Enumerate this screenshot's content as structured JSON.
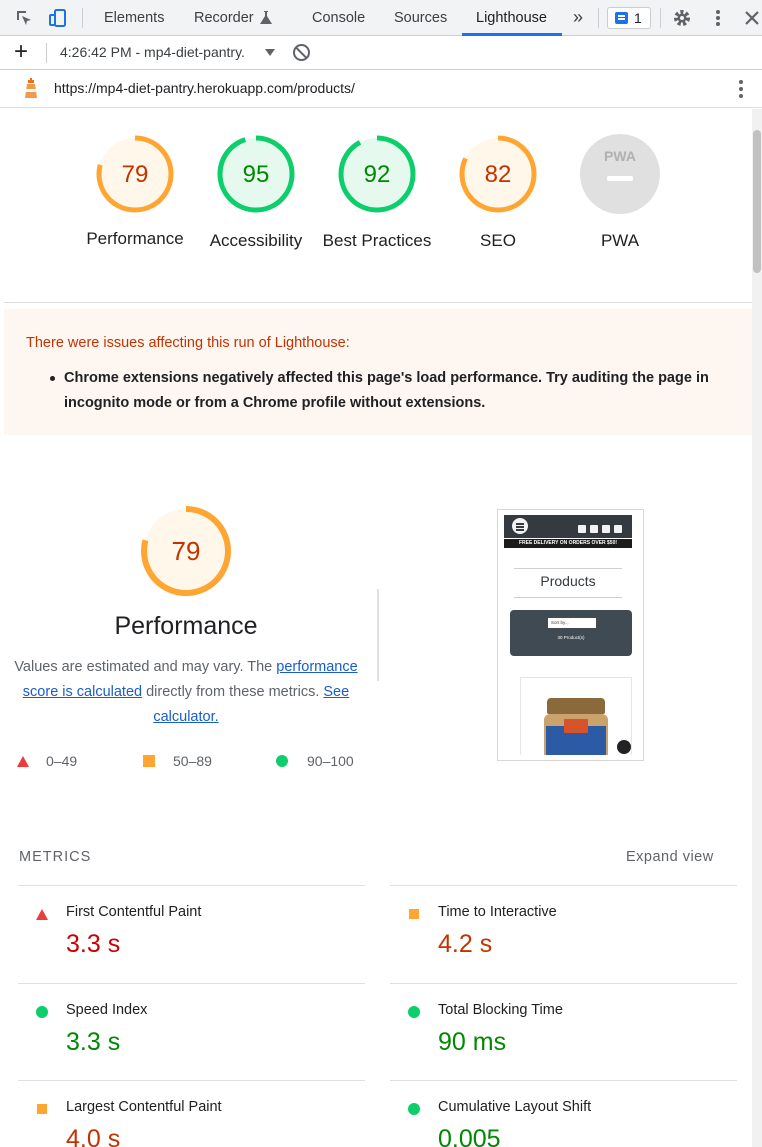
{
  "devtools": {
    "tabs": [
      "Elements",
      "Recorder",
      "Console",
      "Sources",
      "Lighthouse"
    ],
    "active_tab": "Lighthouse",
    "more_tabs": "»",
    "issues_count": "1",
    "report_selector": "4:26:42 PM - mp4-diet-pantry.",
    "new_report": "+",
    "icons": [
      "inspect-icon",
      "device-toolbar-icon",
      "flask-icon",
      "chevron-double-right-icon",
      "issues-icon",
      "gear-icon",
      "kebab-menu-icon",
      "close-icon",
      "clear-icon",
      "lighthouse-icon"
    ]
  },
  "url": "https://mp4-diet-pantry.herokuapp.com/products/",
  "scores": {
    "performance": {
      "value": 79,
      "label": "Performance"
    },
    "accessibility": {
      "value": 95,
      "label": "Accessibility"
    },
    "best_practices": {
      "value": 92,
      "label": "Best Practices"
    },
    "seo": {
      "value": 82,
      "label": "SEO"
    },
    "pwa": {
      "label": "PWA",
      "badge": "PWA"
    }
  },
  "colors": {
    "average": "#ffa531",
    "average_text": "#c33300",
    "pass": "#0cce6b",
    "pass_text": "#008800",
    "fail": "#eb3b3b",
    "fail_text": "#cc0000",
    "link": "#1a5dc8"
  },
  "warning": {
    "title": "There were issues affecting this run of Lighthouse:",
    "items": [
      "Chrome extensions negatively affected this page's load performance. Try auditing the page in incognito mode or from a Chrome profile without extensions."
    ]
  },
  "performance_section": {
    "score": "79",
    "title": "Performance",
    "desc_part1": "Values are estimated and may vary. The",
    "link1": "performance score is calculated",
    "desc_part2": "directly from these metrics.",
    "link2": "See calculator.",
    "legend": [
      "0–49",
      "50–89",
      "90–100"
    ]
  },
  "thumbnail": {
    "banner": "FREE DELIVERY ON ORDERS OVER $50!",
    "title": "Products",
    "sort": "Sort by...",
    "count": "30 Product(s)"
  },
  "metrics": {
    "heading": "METRICS",
    "expand": "Expand view",
    "items": [
      {
        "title": "First Contentful Paint",
        "value": "3.3 s",
        "status": "fail"
      },
      {
        "title": "Time to Interactive",
        "value": "4.2 s",
        "status": "average"
      },
      {
        "title": "Speed Index",
        "value": "3.3 s",
        "status": "pass"
      },
      {
        "title": "Total Blocking Time",
        "value": "90 ms",
        "status": "pass"
      },
      {
        "title": "Largest Contentful Paint",
        "value": "4.0 s",
        "status": "average"
      },
      {
        "title": "Cumulative Layout Shift",
        "value": "0.005",
        "status": "pass"
      }
    ]
  }
}
